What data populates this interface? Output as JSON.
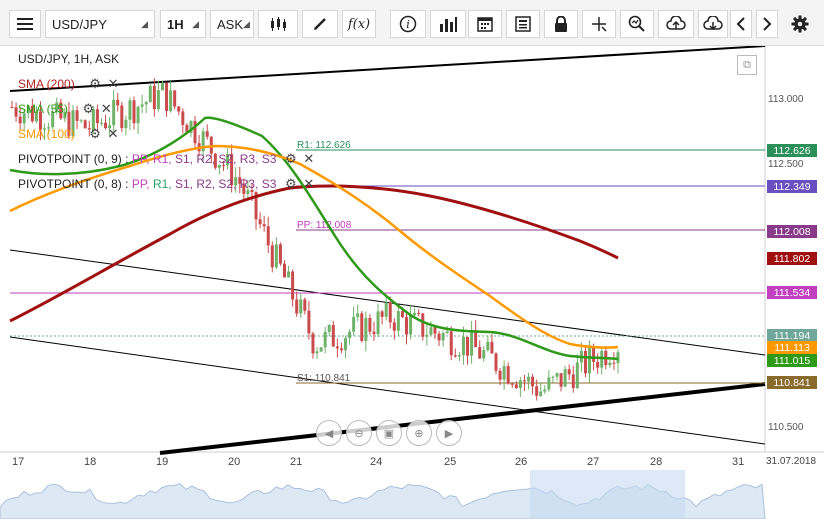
{
  "toolbar": {
    "symbol": "USD/JPY",
    "timeframe": "1H",
    "price_type": "ASK",
    "icons": [
      "menu-icon",
      "candlestick-icon",
      "draw-pen-icon",
      "function-icon",
      "info-icon",
      "bar-chart-icon",
      "calendar-icon",
      "news-icon",
      "lock-icon",
      "crosshair-icon",
      "zoom-icon",
      "upload-icon",
      "download-icon",
      "chevron-left-icon",
      "chevron-right-icon",
      "gear-icon"
    ]
  },
  "chart": {
    "title": "USD/JPY, 1H, ASK",
    "indicators": [
      {
        "label": "SMA (200)",
        "color": "#b22222"
      },
      {
        "label": "SMA (55)",
        "color": "#2e9a18"
      },
      {
        "label": "SMA (100)",
        "color": "#ff9900"
      }
    ],
    "pivots": [
      {
        "name": "PIVOTPOINT (0, 9)",
        "sep": " : ",
        "levels": [
          "PP,",
          "R1,",
          "S1,",
          "R2,",
          "S2,",
          "R3,",
          "S3"
        ],
        "colors": [
          "#c040c0",
          "#c040c0",
          "#8a3a8a",
          "#8a3a8a",
          "#8a3a8a",
          "#8a3a8a",
          "#8a3a8a"
        ]
      },
      {
        "name": "PIVOTPOINT (0, 8)",
        "sep": " : ",
        "levels": [
          "PP,",
          "R1,",
          "S1,",
          "R2,",
          "S2,",
          "R3,",
          "S3"
        ],
        "colors": [
          "#c040c0",
          "#2aa060",
          "#8a3a8a",
          "#8a3a8a",
          "#8a3a8a",
          "#8a3a8a",
          "#8a3a8a"
        ]
      }
    ],
    "annotations": {
      "r1": "R1: 112.626",
      "pp": "PP: 112.008",
      "s1": "S1: 110.841"
    },
    "price_labels": [
      {
        "value": "112.626",
        "color": "#2b8f5a"
      },
      {
        "value": "112.349",
        "color": "#6a4fc0"
      },
      {
        "value": "112.008",
        "color": "#8a3a8a"
      },
      {
        "value": "111.802",
        "color": "#a01010"
      },
      {
        "value": "111.534",
        "color": "#c040c0"
      },
      {
        "value": "111.194",
        "color": "#6fa89a"
      },
      {
        "value": "111.113",
        "color": "#ff9900"
      },
      {
        "value": "111.015",
        "color": "#2e9a18"
      },
      {
        "value": "110.841",
        "color": "#8a6a2a"
      }
    ],
    "y_ticks": [
      "113.000",
      "112.500",
      "110.500"
    ],
    "x_ticks": [
      "17",
      "18",
      "19",
      "20",
      "21",
      "24",
      "25",
      "26",
      "27",
      "28",
      "31",
      "31.07.2018"
    ]
  },
  "chart_data": {
    "type": "line",
    "title": "USD/JPY, 1H, ASK",
    "x": [
      "17",
      "18",
      "19",
      "20",
      "21",
      "24",
      "25",
      "26",
      "27",
      "28",
      "31"
    ],
    "ylim": [
      110.3,
      113.3
    ],
    "series": [
      {
        "name": "USD/JPY",
        "values": [
          112.85,
          112.7,
          112.95,
          112.3,
          111.1,
          111.3,
          111.1,
          110.75,
          111.1,
          null,
          null
        ]
      },
      {
        "name": "SMA (200)",
        "values": [
          111.5,
          111.75,
          112.1,
          112.3,
          112.35,
          112.35,
          112.25,
          112.05,
          111.82,
          null,
          null
        ]
      },
      {
        "name": "SMA (55)",
        "values": [
          112.45,
          112.6,
          112.8,
          112.9,
          112.3,
          111.5,
          111.15,
          111.15,
          111.02,
          null,
          null
        ]
      },
      {
        "name": "SMA (100)",
        "values": [
          112.2,
          112.35,
          112.55,
          112.7,
          112.6,
          112.3,
          111.8,
          111.35,
          111.11,
          null,
          null
        ]
      }
    ],
    "levels": [
      {
        "name": "R1",
        "value": 112.626
      },
      {
        "name": "PP",
        "value": 112.008
      },
      {
        "name": "S1",
        "value": 110.841
      }
    ],
    "last": {
      "ask": 111.194,
      "sma100": 111.113,
      "sma55": 111.015
    }
  }
}
